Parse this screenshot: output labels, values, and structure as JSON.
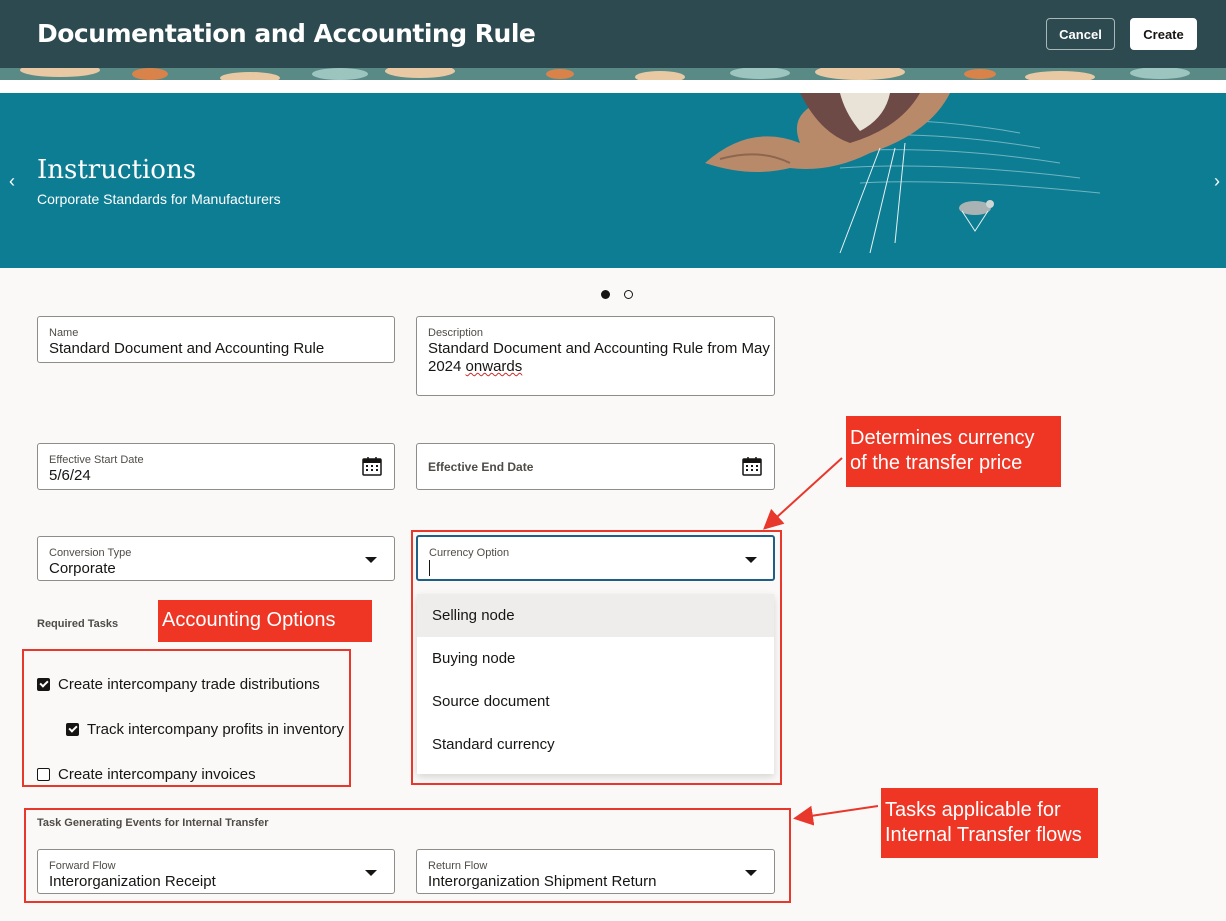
{
  "header": {
    "title": "Documentation and Accounting Rule",
    "cancel_label": "Cancel",
    "create_label": "Create"
  },
  "banner": {
    "title": "Instructions",
    "subtitle": "Corporate Standards for Manufacturers",
    "prev_arrow": "‹",
    "next_arrow": "›",
    "active_slide": 1,
    "total_slides": 2
  },
  "form": {
    "name": {
      "label": "Name",
      "value": "Standard Document and Accounting Rule"
    },
    "description": {
      "label": "Description",
      "value_line1": "Standard Document and Accounting Rule from May",
      "value_line2_pre": "2024 ",
      "value_line2_flagged": "onwards"
    },
    "effective_start_date": {
      "label": "Effective Start Date",
      "value": "5/6/24"
    },
    "effective_end_date": {
      "label": "Effective End Date",
      "value": ""
    },
    "conversion_type": {
      "label": "Conversion Type",
      "value": "Corporate"
    },
    "currency_option": {
      "label": "Currency Option",
      "value": "",
      "options": [
        "Selling node",
        "Buying node",
        "Source document",
        "Standard currency"
      ],
      "highlighted": "Selling node"
    },
    "required_tasks": {
      "label": "Required Tasks",
      "items": [
        {
          "label": "Create intercompany trade distributions",
          "checked": true
        },
        {
          "label": "Track intercompany profits in inventory",
          "checked": true
        },
        {
          "label": "Create intercompany invoices",
          "checked": false
        }
      ]
    },
    "task_generating_events": {
      "label": "Task Generating Events for Internal Transfer",
      "forward_flow": {
        "label": "Forward Flow",
        "value": "Interorganization Receipt"
      },
      "return_flow": {
        "label": "Return Flow",
        "value": "Interorganization Shipment Return"
      }
    }
  },
  "annotations": {
    "currency_note_line1": "Determines currency",
    "currency_note_line2": "of the transfer price",
    "accounting_options": "Accounting Options",
    "tasks_note_line1": "Tasks applicable for",
    "tasks_note_line2": "Internal Transfer flows",
    "color": "#ef3524"
  },
  "colors": {
    "header_bg": "#2c4a4f",
    "banner_bg": "#0d7d93",
    "page_bg": "#fbf9f8"
  }
}
